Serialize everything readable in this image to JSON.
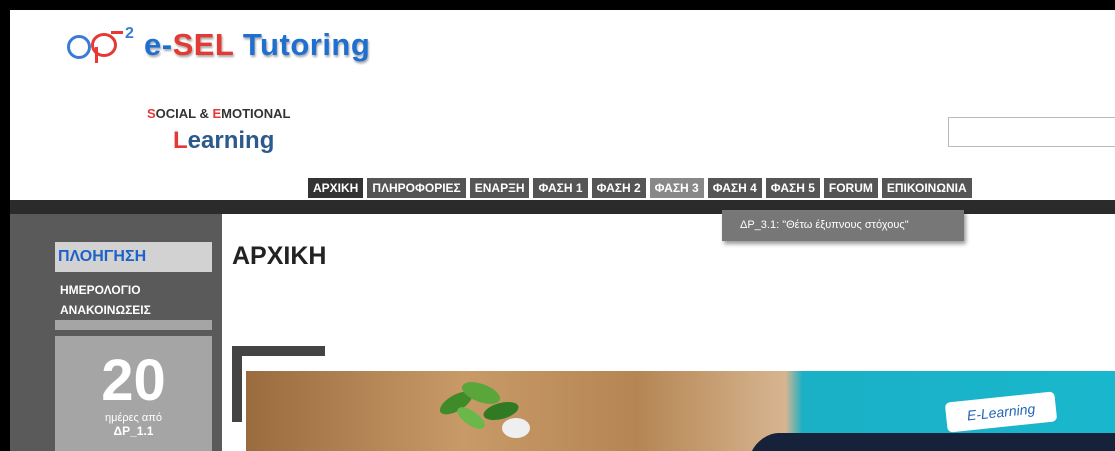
{
  "brand": {
    "logo_sup": "2",
    "title_prefix": "e-",
    "title_accent": "SEL",
    "title_rest": " Tutoring",
    "subtitle_s": "S",
    "subtitle_rest1": "OCIAL & ",
    "subtitle_e": "E",
    "subtitle_rest2": "MOTIONAL",
    "learning_l": "L",
    "learning_rest": "earning",
    "colors": {
      "blue": "#1f6fd1",
      "red": "#e53935"
    }
  },
  "nav": {
    "items": [
      {
        "label": "ΑΡΧΙΚΗ",
        "state": "active"
      },
      {
        "label": "ΠΛΗΡΟΦΟΡΙΕΣ"
      },
      {
        "label": "ΕΝΑΡΞΗ"
      },
      {
        "label": "ΦΑΣΗ 1"
      },
      {
        "label": "ΦΑΣΗ 2"
      },
      {
        "label": "ΦΑΣΗ 3",
        "state": "hover"
      },
      {
        "label": "ΦΑΣΗ 4"
      },
      {
        "label": "ΦΑΣΗ 5"
      },
      {
        "label": "FORUM"
      },
      {
        "label": "ΕΠΙΚΟΙΝΩΝΙΑ"
      }
    ],
    "dropdown_item": "ΔΡ_3.1: \"Θέτω έξυπνους στόχους\""
  },
  "sidebar": {
    "heading": "ΠΛΟΗΓΗΣΗ",
    "links": [
      "ΗΜΕΡΟΛΟΓΙΟ",
      "ΑΝΑΚΟΙΝΩΣΕΙΣ"
    ],
    "counter_value": "20",
    "counter_line1": "ημέρες από",
    "counter_line2": "ΔΡ_1.1"
  },
  "main": {
    "title": "ΑΡΧΙΚΗ",
    "banner_badge": "E-Learning"
  }
}
